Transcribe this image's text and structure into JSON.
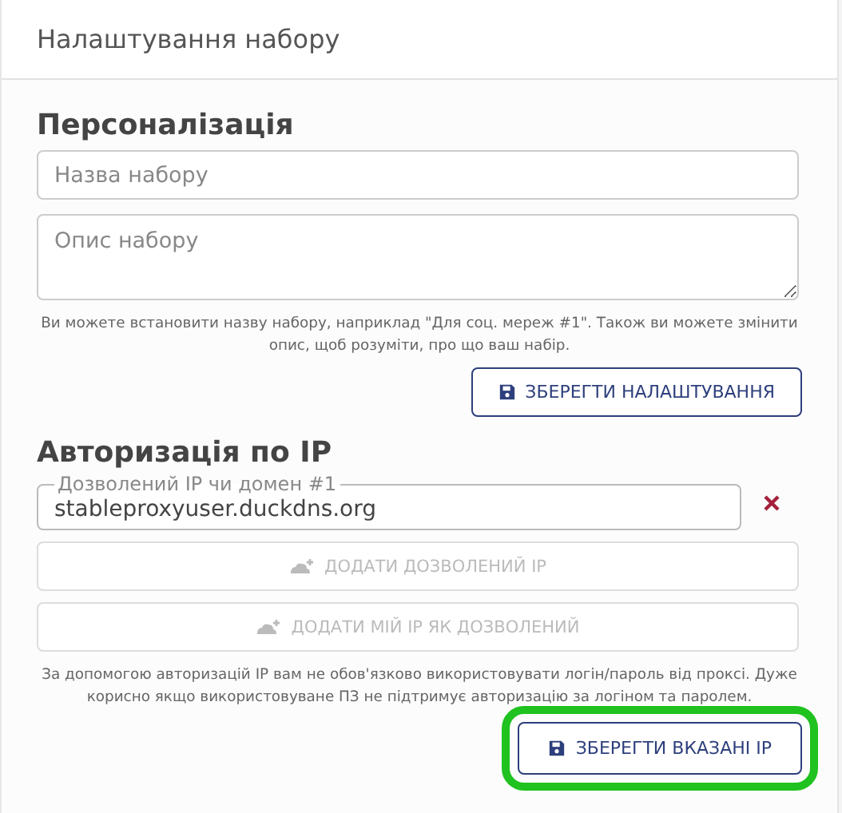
{
  "header": {
    "title": "Налаштування набору"
  },
  "personalization": {
    "title": "Персоналізація",
    "name_field": {
      "placeholder": "Назва набору"
    },
    "description_field": {
      "placeholder": "Опис набору"
    },
    "hint": "Ви можете встановити назву набору, наприклад \"Для соц. мереж #1\". Також ви можете змінити опис, щоб розуміти, про що ваш набір.",
    "save_button": {
      "label": "ЗБЕРЕГТИ НАЛАШТУВАННЯ",
      "disabled": false,
      "highlighted": false
    }
  },
  "ip_auth": {
    "title": "Авторизація по IP",
    "entries": [
      {
        "label": "Дозволений IP чи домен #1",
        "value": "stableproxyuser.duckdns.org"
      }
    ],
    "actions": [
      {
        "label": "ДОДАТИ ДОЗВОЛЕНИЙ IP",
        "disabled": true
      },
      {
        "label": "ДОДАТИ МІЙ IP ЯК ДОЗВОЛЕНИЙ",
        "disabled": true
      }
    ],
    "hint": "За допомогою авторизацій IP вам не обов'язково використовувати логін/пароль від проксі. Дуже корисно якщо використовуване ПЗ не підтримує авторизацію за логіном та паролем.",
    "save_button": {
      "label": "ЗБЕРЕГТИ ВКАЗАНІ IP",
      "disabled": false,
      "highlighted": true
    }
  }
}
